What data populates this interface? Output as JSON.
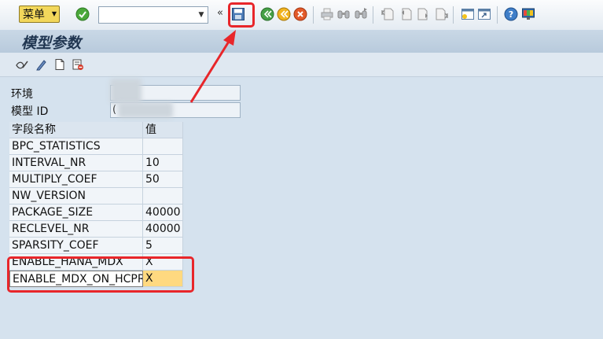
{
  "toolbar": {
    "menu_label": "菜单",
    "icons": [
      "check-icon",
      "dropdown-icon",
      "double-left-icon",
      "save-icon",
      "back-icon",
      "exit-icon",
      "cancel-icon",
      "print-icon",
      "find-icon",
      "find-next-icon",
      "first-page-icon",
      "previous-page-icon",
      "next-page-icon",
      "last-page-icon",
      "create-session-icon",
      "shortcut-icon",
      "help-icon",
      "customize-layout-icon"
    ]
  },
  "title": "模型参数",
  "app_toolbar": {
    "icons": [
      "display-change-icon",
      "edit-icon",
      "new-entry-icon",
      "delete-row-icon"
    ]
  },
  "header": {
    "env_label": "环境",
    "model_id_label": "模型 ID",
    "model_id_value_prefix": "("
  },
  "table": {
    "columns": [
      "字段名称",
      "值"
    ],
    "rows": [
      {
        "name": "BPC_STATISTICS",
        "value": ""
      },
      {
        "name": "INTERVAL_NR",
        "value": "10"
      },
      {
        "name": "MULTIPLY_COEF",
        "value": "50"
      },
      {
        "name": "NW_VERSION",
        "value": ""
      },
      {
        "name": "PACKAGE_SIZE",
        "value": "40000"
      },
      {
        "name": "RECLEVEL_NR",
        "value": "40000"
      },
      {
        "name": "SPARSITY_COEF",
        "value": "5"
      },
      {
        "name": "ENABLE_HANA_MDX",
        "value": "X"
      },
      {
        "name": "ENABLE_MDX_ON_HCPR",
        "value": "X"
      }
    ]
  },
  "colors": {
    "annotation": "#e8262a",
    "background": "#d5e2ee",
    "title_text": "#1f3550",
    "selected_value": "#ffd980",
    "menu_button": "#f2d75b"
  }
}
